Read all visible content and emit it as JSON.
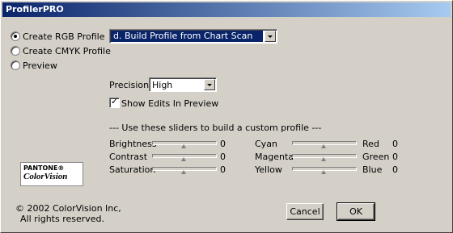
{
  "window": {
    "title": "ProfilerPRO"
  },
  "mode": {
    "options": [
      {
        "label": "Create RGB Profile",
        "checked": true
      },
      {
        "label": "Create CMYK Profile",
        "checked": false
      },
      {
        "label": "Preview",
        "checked": false
      }
    ],
    "selected_task": "d. Build Profile from Chart Scan"
  },
  "precision": {
    "label": "Precision:",
    "value": "High"
  },
  "show_edits": {
    "label": "Show Edits In Preview",
    "checked": true
  },
  "sliders_hint": "--- Use these sliders to build a custom profile ---",
  "sliders": {
    "brightness": {
      "label": "Brightness",
      "value": "0"
    },
    "contrast": {
      "label": "Contrast",
      "value": "0"
    },
    "saturation": {
      "label": "Saturation",
      "value": "0"
    },
    "cyan": {
      "label": "Cyan",
      "value": "0",
      "opposite": "Red"
    },
    "magenta": {
      "label": "Magenta",
      "value": "0",
      "opposite": "Green"
    },
    "yellow": {
      "label": "Yellow",
      "value": "0",
      "opposite": "Blue"
    }
  },
  "logo": {
    "line1": "PANTONE®",
    "line2": "ColorVision"
  },
  "copyright": {
    "line1": "© 2002 ColorVision Inc,",
    "line2": "All rights reserved."
  },
  "buttons": {
    "cancel": "Cancel",
    "ok": "OK"
  }
}
